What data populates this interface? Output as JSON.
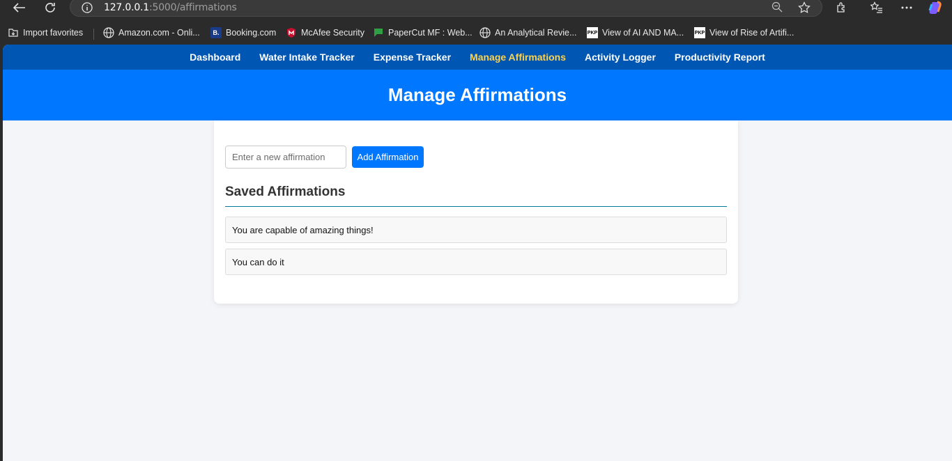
{
  "browser": {
    "url_host": "127.0.0.1",
    "url_path": ":5000/affirmations",
    "bookmarks": [
      {
        "label": "Import favorites",
        "icon": "import-icon"
      },
      {
        "label": "Amazon.com - Onli...",
        "icon": "globe-icon"
      },
      {
        "label": "Booking.com",
        "icon": "booking-icon",
        "badge": "B."
      },
      {
        "label": "McAfee Security",
        "icon": "mcafee-icon"
      },
      {
        "label": "PaperCut MF : Web...",
        "icon": "papercut-icon"
      },
      {
        "label": "An Analytical Revie...",
        "icon": "globe-icon"
      },
      {
        "label": "View of AI AND MA...",
        "icon": "pkp-icon",
        "badge": "PKP"
      },
      {
        "label": "View of Rise of Artifi...",
        "icon": "pkp-icon",
        "badge": "PKP"
      }
    ]
  },
  "nav": {
    "items": [
      {
        "label": "Dashboard"
      },
      {
        "label": "Water Intake Tracker"
      },
      {
        "label": "Expense Tracker"
      },
      {
        "label": "Manage Affirmations"
      },
      {
        "label": "Activity Logger"
      },
      {
        "label": "Productivity Report"
      }
    ],
    "active_index": 3
  },
  "header": {
    "title": "Manage Affirmations"
  },
  "form": {
    "placeholder": "Enter a new affirmation",
    "button_label": "Add Affirmation"
  },
  "saved": {
    "heading": "Saved Affirmations",
    "items": [
      {
        "text": "You are capable of amazing things!"
      },
      {
        "text": "You can do it"
      }
    ]
  },
  "colors": {
    "nav_bg": "#0056b3",
    "header_bg": "#0077ff",
    "active_nav": "#ffd24d",
    "page_bg": "#f4f5f9"
  }
}
